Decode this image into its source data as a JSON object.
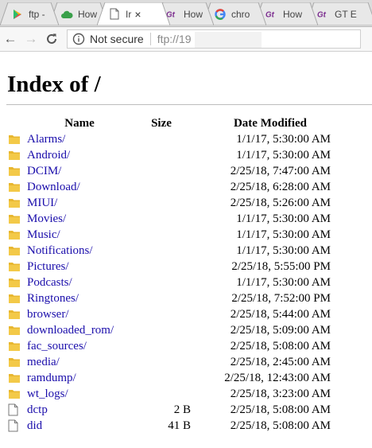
{
  "tabs": [
    {
      "label": "ftp -",
      "icon": "play-store-icon",
      "active": false
    },
    {
      "label": "How",
      "icon": "cloud-icon",
      "active": false
    },
    {
      "label": "Ir",
      "icon": "page-icon",
      "active": true
    },
    {
      "label": "How",
      "icon": "gt-icon",
      "active": false
    },
    {
      "label": "chro",
      "icon": "google-icon",
      "active": false
    },
    {
      "label": "How",
      "icon": "gt-icon",
      "active": false
    },
    {
      "label": "GT E",
      "icon": "gt-icon",
      "active": false
    }
  ],
  "active_tab_close": "×",
  "omnibox": {
    "security": "Not secure",
    "url": "ftp://19"
  },
  "page": {
    "title": "Index of /",
    "headers": {
      "name": "Name",
      "size": "Size",
      "date": "Date Modified"
    }
  },
  "entries": [
    {
      "name": "Alarms/",
      "size": "",
      "date": "1/1/17, 5:30:00 AM",
      "type": "folder"
    },
    {
      "name": "Android/",
      "size": "",
      "date": "1/1/17, 5:30:00 AM",
      "type": "folder"
    },
    {
      "name": "DCIM/",
      "size": "",
      "date": "2/25/18, 7:47:00 AM",
      "type": "folder"
    },
    {
      "name": "Download/",
      "size": "",
      "date": "2/25/18, 6:28:00 AM",
      "type": "folder"
    },
    {
      "name": "MIUI/",
      "size": "",
      "date": "2/25/18, 5:26:00 AM",
      "type": "folder"
    },
    {
      "name": "Movies/",
      "size": "",
      "date": "1/1/17, 5:30:00 AM",
      "type": "folder"
    },
    {
      "name": "Music/",
      "size": "",
      "date": "1/1/17, 5:30:00 AM",
      "type": "folder"
    },
    {
      "name": "Notifications/",
      "size": "",
      "date": "1/1/17, 5:30:00 AM",
      "type": "folder"
    },
    {
      "name": "Pictures/",
      "size": "",
      "date": "2/25/18, 5:55:00 PM",
      "type": "folder"
    },
    {
      "name": "Podcasts/",
      "size": "",
      "date": "1/1/17, 5:30:00 AM",
      "type": "folder"
    },
    {
      "name": "Ringtones/",
      "size": "",
      "date": "2/25/18, 7:52:00 PM",
      "type": "folder"
    },
    {
      "name": "browser/",
      "size": "",
      "date": "2/25/18, 5:44:00 AM",
      "type": "folder"
    },
    {
      "name": "downloaded_rom/",
      "size": "",
      "date": "2/25/18, 5:09:00 AM",
      "type": "folder"
    },
    {
      "name": "fac_sources/",
      "size": "",
      "date": "2/25/18, 5:08:00 AM",
      "type": "folder"
    },
    {
      "name": "media/",
      "size": "",
      "date": "2/25/18, 2:45:00 AM",
      "type": "folder"
    },
    {
      "name": "ramdump/",
      "size": "",
      "date": "2/25/18, 12:43:00 AM",
      "type": "folder"
    },
    {
      "name": "wt_logs/",
      "size": "",
      "date": "2/25/18, 3:23:00 AM",
      "type": "folder"
    },
    {
      "name": "dctp",
      "size": "2 B",
      "date": "2/25/18, 5:08:00 AM",
      "type": "file"
    },
    {
      "name": "did",
      "size": "41 B",
      "date": "2/25/18, 5:08:00 AM",
      "type": "file"
    }
  ],
  "colors": {
    "link": "#1a0dab",
    "folder": "#e8b730",
    "tabbar": "#dcdcdc"
  }
}
